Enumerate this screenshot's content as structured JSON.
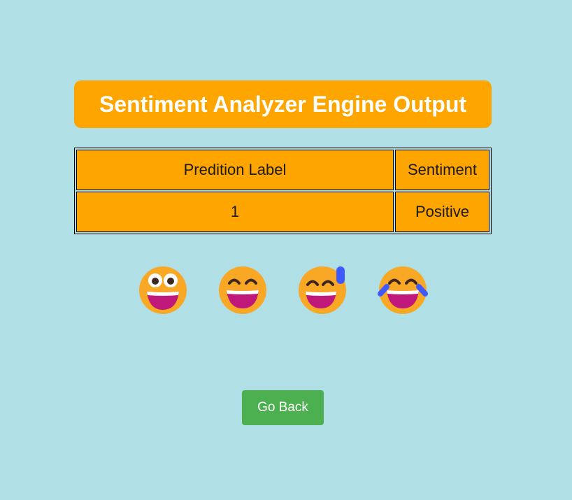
{
  "header": {
    "title": "Sentiment Analyzer Engine Output"
  },
  "results_table": {
    "columns": [
      "Predition Label",
      "Sentiment"
    ],
    "rows": [
      [
        "1",
        "Positive"
      ]
    ]
  },
  "emojis": [
    {
      "icon": "grinning-face-big-eyes-icon"
    },
    {
      "icon": "grinning-face-smiling-eyes-icon"
    },
    {
      "icon": "grinning-face-sweat-icon"
    },
    {
      "icon": "face-tears-of-joy-icon"
    }
  ],
  "actions": {
    "go_back_label": "Go Back"
  },
  "colors": {
    "background": "#b0e0e6",
    "accent": "#ffa500",
    "button": "#4caf50",
    "emoji_face": "#f9a825",
    "emoji_mouth": "#c0187a",
    "emoji_tear": "#3d5afe"
  }
}
